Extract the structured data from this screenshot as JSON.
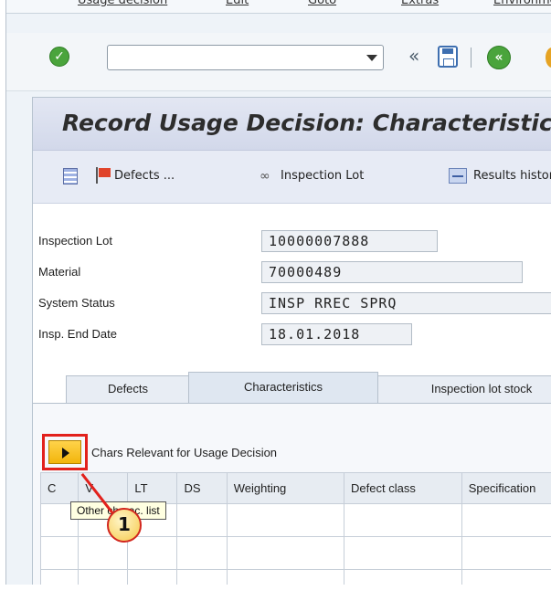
{
  "menu": {
    "items": [
      "Usage decision",
      "Edit",
      "Goto",
      "Extras",
      "Environment"
    ]
  },
  "toolbar": {
    "command_field_value": "",
    "ok_icon": "check-icon",
    "save_icon": "save-icon",
    "back_icon": "back-icon"
  },
  "title": "Record Usage Decision: Characteristic Overview",
  "app_toolbar": {
    "defects_label": "Defects ...",
    "inspection_lot_label": "Inspection Lot",
    "results_label": "Results history"
  },
  "fields": {
    "inspection_lot": {
      "label": "Inspection Lot",
      "value": "10000007888"
    },
    "material": {
      "label": "Material",
      "value": "70000489"
    },
    "system_status": {
      "label": "System Status",
      "value": "INSP RREC SPRQ"
    },
    "insp_end_date": {
      "label": "Insp. End Date",
      "value": "18.01.2018"
    }
  },
  "tabs": [
    {
      "label": "Defects",
      "active": false
    },
    {
      "label": "Characteristics",
      "active": true
    },
    {
      "label": "Inspection lot stock",
      "active": false
    }
  ],
  "characteristics": {
    "section_label": "Chars Relevant for Usage Decision",
    "tooltip": "Other charac. list",
    "callout_number": "1",
    "columns": [
      "C",
      "V",
      "LT",
      "DS",
      "Weighting",
      "Defect class",
      "Specification"
    ]
  },
  "colors": {
    "highlight": "#e2211c",
    "title_bar": "#d2d8ea",
    "button_yellow": "#f2b50c"
  }
}
